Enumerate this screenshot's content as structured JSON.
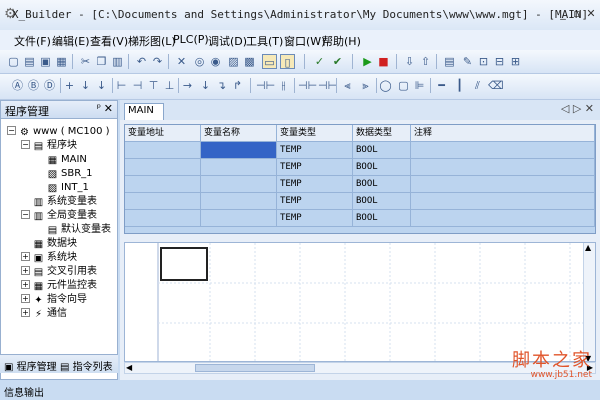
{
  "window": {
    "title": "X_Builder - [C:\\Documents and Settings\\Administrator\\My Documents\\www\\www.mgt] - [MAIN]",
    "minimize_glyph": "_",
    "restore_glyph": "▫",
    "close_glyph": "✕"
  },
  "menu": [
    {
      "label": "文件(F)"
    },
    {
      "label": "编辑(E)"
    },
    {
      "label": "查看(V)"
    },
    {
      "label": "梯形图(L)"
    },
    {
      "label": "PLC(P)"
    },
    {
      "label": "调试(D)"
    },
    {
      "label": "工具(T)"
    },
    {
      "label": "窗口(W)"
    },
    {
      "label": "帮助(H)"
    }
  ],
  "left_panel": {
    "title": "程序管理",
    "pin_glyph": "ᵖ",
    "close_glyph": "✕",
    "tree": [
      {
        "label": "www ( MC100 )",
        "expander": "−",
        "icon": "project-icon"
      },
      {
        "label": "程序块",
        "expander": "−",
        "icon": "folder-icon"
      },
      {
        "label": "MAIN",
        "expander": "",
        "icon": "program-icon"
      },
      {
        "label": "SBR_1",
        "expander": "",
        "icon": "subroutine-icon"
      },
      {
        "label": "INT_1",
        "expander": "",
        "icon": "interrupt-icon"
      },
      {
        "label": "系统变量表",
        "expander": "",
        "icon": "table-icon"
      },
      {
        "label": "全局变量表",
        "expander": "−",
        "icon": "table-icon"
      },
      {
        "label": "默认变量表",
        "expander": "",
        "icon": "table-icon"
      },
      {
        "label": "数据块",
        "expander": "",
        "icon": "data-block-icon"
      },
      {
        "label": "系统块",
        "expander": "+",
        "icon": "system-block-icon"
      },
      {
        "label": "交叉引用表",
        "expander": "+",
        "icon": "cross-ref-icon"
      },
      {
        "label": "元件监控表",
        "expander": "+",
        "icon": "monitor-icon"
      },
      {
        "label": "指令向导",
        "expander": "+",
        "icon": "wizard-icon"
      },
      {
        "label": "通信",
        "expander": "+",
        "icon": "communication-icon"
      }
    ],
    "bottom_tabs": [
      {
        "label": "程序管理"
      },
      {
        "label": "指令列表"
      }
    ]
  },
  "editor": {
    "tab_label": "MAIN",
    "tab_nav": "◁ ▷ ✕",
    "variable_table": {
      "columns": [
        "变量地址",
        "变量名称",
        "变量类型",
        "数据类型",
        "注释"
      ],
      "rows": [
        [
          "",
          "",
          "TEMP",
          "BOOL",
          ""
        ],
        [
          "",
          "",
          "TEMP",
          "BOOL",
          ""
        ],
        [
          "",
          "",
          "TEMP",
          "BOOL",
          ""
        ],
        [
          "",
          "",
          "TEMP",
          "BOOL",
          ""
        ],
        [
          "",
          "",
          "TEMP",
          "BOOL",
          ""
        ]
      ]
    }
  },
  "statusbar": {
    "label": "信息输出"
  },
  "watermark": {
    "line1": "脚本之家",
    "line2": "www.jb51.net"
  }
}
